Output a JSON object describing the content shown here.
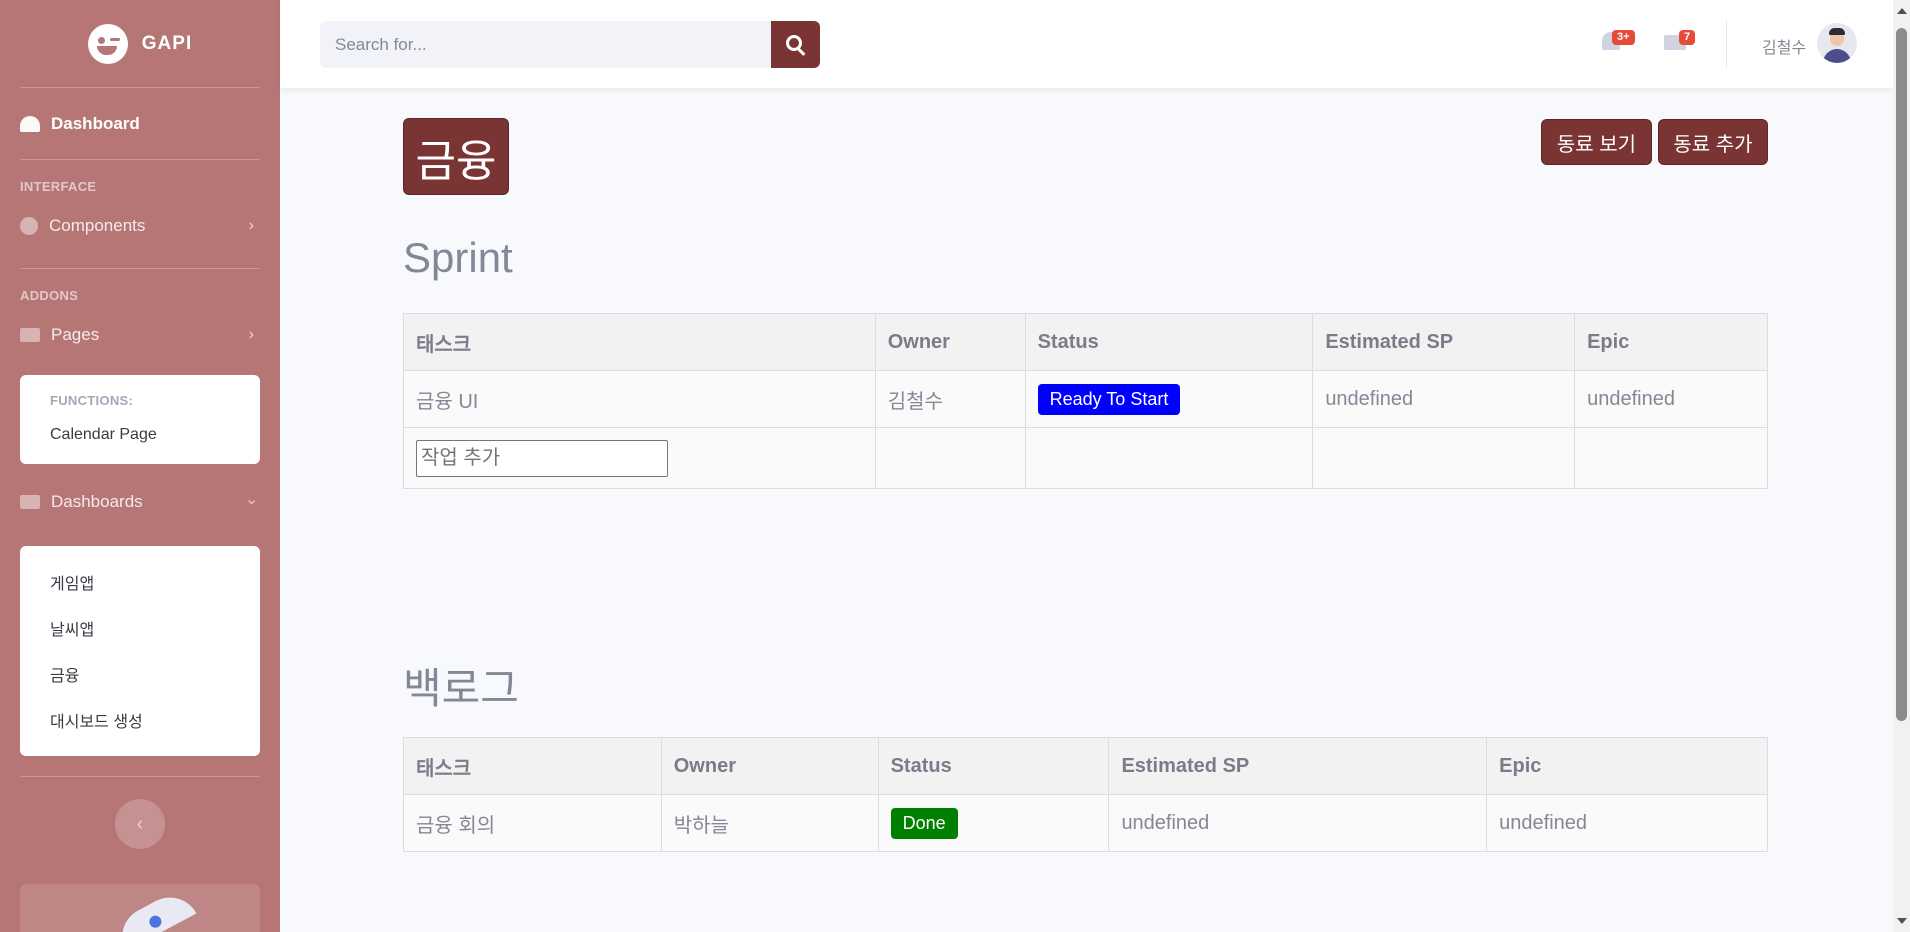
{
  "sidebar": {
    "brand": "GAPI",
    "dashboard": "Dashboard",
    "heading_interface": "INTERFACE",
    "components": "Components",
    "heading_addons": "ADDONS",
    "pages": "Pages",
    "pages_menu": {
      "header": "FUNCTIONS:",
      "items": [
        "Calendar Page"
      ]
    },
    "dashboards": "Dashboards",
    "dashboards_menu": {
      "items": [
        "게임앱",
        "날씨앱",
        "금융",
        "대시보드 생성"
      ]
    }
  },
  "topbar": {
    "search_placeholder": "Search for...",
    "alerts_badge": "3+",
    "messages_badge": "7",
    "user_name": "김철수"
  },
  "main": {
    "title": "금융",
    "view_colleagues": "동료 보기",
    "add_colleague": "동료 추가",
    "sprint": {
      "title": "Sprint",
      "headers": [
        "태스크",
        "Owner",
        "Status",
        "Estimated SP",
        "Epic"
      ],
      "rows": [
        {
          "task": "금융 UI",
          "owner": "김철수",
          "status": "Ready To Start",
          "status_color": "#0000ff",
          "sp": "undefined",
          "epic": "undefined"
        }
      ],
      "add_placeholder": "작업 추가"
    },
    "backlog": {
      "title": "백로그",
      "headers": [
        "태스크",
        "Owner",
        "Status",
        "Estimated SP",
        "Epic"
      ],
      "rows": [
        {
          "task": "금융 회의",
          "owner": "박하늘",
          "status": "Done",
          "status_color": "#008000",
          "sp": "undefined",
          "epic": "undefined"
        }
      ]
    }
  },
  "colors": {
    "sidebar": "#b77676",
    "accent": "#7a3434"
  }
}
